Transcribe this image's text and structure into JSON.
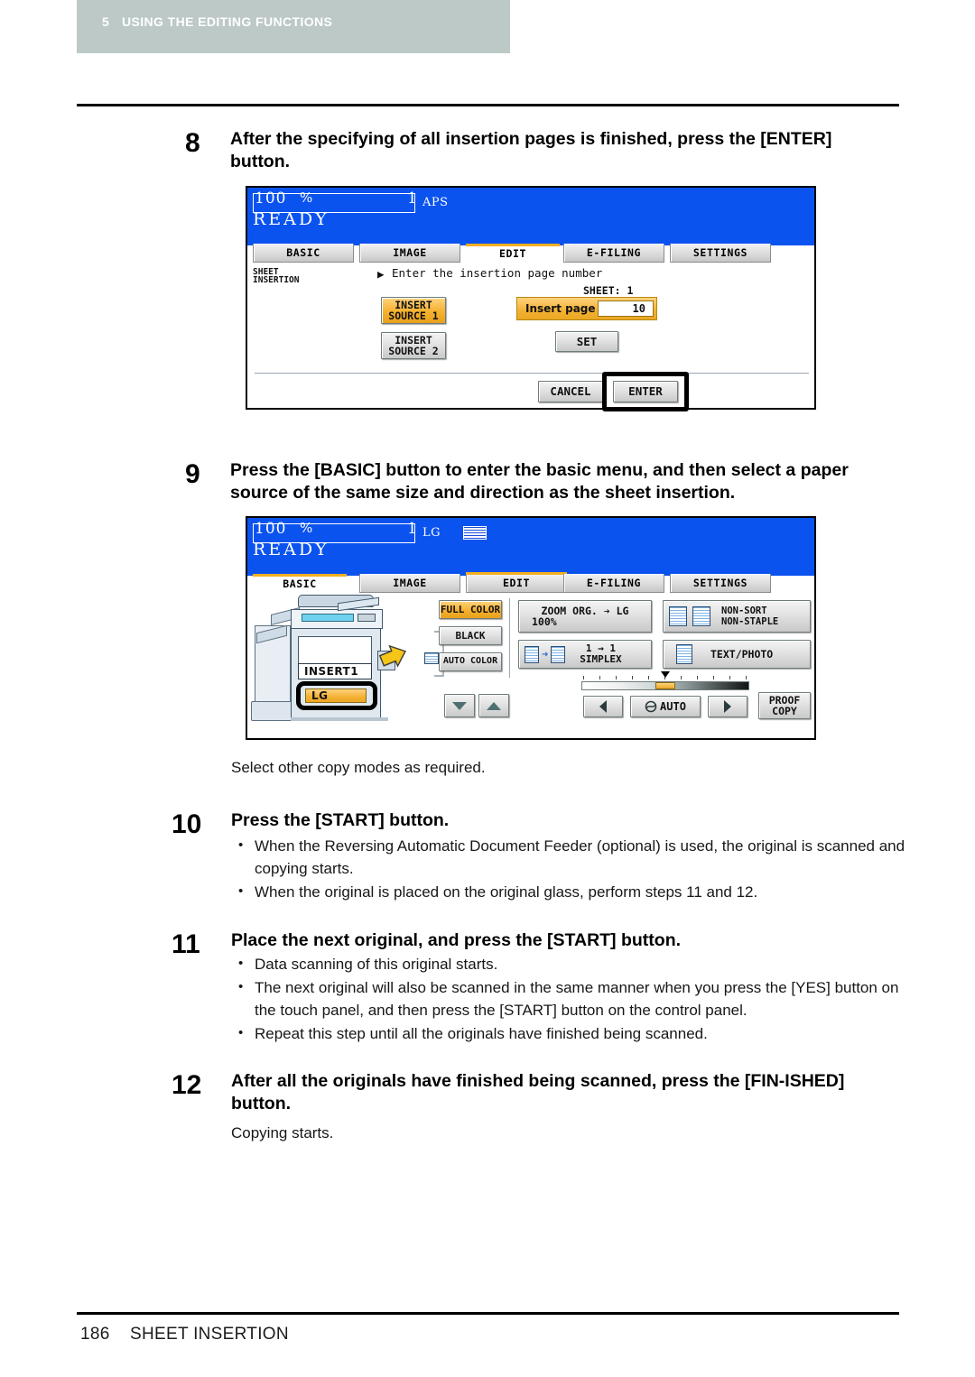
{
  "header": {
    "chapter_number": "5",
    "chapter_title": "USING THE EDITING FUNCTIONS"
  },
  "footer": {
    "page_number": "186",
    "section_title": "SHEET INSERTION"
  },
  "steps": [
    {
      "number": "8",
      "heading": "After the specifying of all insertion pages is finished, press the [ENTER] button."
    },
    {
      "number": "9",
      "heading": "Press the [BASIC] button to enter the basic menu, and then select a paper source of the same size and direction as the sheet insertion.",
      "note": "Select other copy modes as required."
    },
    {
      "number": "10",
      "heading": "Press the [START] button.",
      "bullets": [
        "When the Reversing Automatic Document Feeder (optional) is used, the original is scanned and copying starts.",
        "When the original is placed on the original glass, perform steps 11 and 12."
      ]
    },
    {
      "number": "11",
      "heading": "Place the next original, and press the [START] button.",
      "bullets": [
        "Data scanning of this original starts.",
        "The next original will also be scanned in the same manner when you press the [YES] button on the touch panel, and then press the [START] button on the control panel.",
        "Repeat this step until all the originals have finished being scanned."
      ]
    },
    {
      "number": "12",
      "heading": "After all the originals have finished being scanned, press the [FIN-ISHED] button.",
      "note": "Copying starts."
    }
  ],
  "panel_edit": {
    "status": {
      "ratio": "100",
      "percent": "%",
      "copies": "1",
      "paper_size": "APS",
      "ready": "READY"
    },
    "tabs": [
      {
        "label": "BASIC",
        "active": false
      },
      {
        "label": "IMAGE",
        "active": false
      },
      {
        "label": "EDIT",
        "active": true
      },
      {
        "label": "E-FILING",
        "active": false
      },
      {
        "label": "SETTINGS",
        "active": false
      }
    ],
    "function_label_line1": "SHEET",
    "function_label_line2": "INSERTION",
    "guide_arrow": "▶",
    "guide_text": "Enter the insertion page number",
    "sheet_counter": "SHEET: 1",
    "insert_source_1": "INSERT\nSOURCE 1",
    "insert_source_2": "INSERT\nSOURCE 2",
    "insert_page_label": "Insert page",
    "insert_page_colon": ":",
    "insert_page_value": "10",
    "set_button": "SET",
    "cancel_button": "CANCEL",
    "enter_button": "ENTER"
  },
  "panel_basic": {
    "status": {
      "ratio": "100",
      "percent": "%",
      "copies": "1",
      "paper_size": "LG",
      "ready": "READY"
    },
    "tabs": [
      {
        "label": "BASIC",
        "active": true
      },
      {
        "label": "IMAGE",
        "active": false
      },
      {
        "label": "EDIT",
        "active": false
      },
      {
        "label": "E-FILING",
        "active": false
      },
      {
        "label": "SETTINGS",
        "active": false
      }
    ],
    "drawer_insert1": "INSERT1",
    "drawer_lg": "LG",
    "color_modes": [
      {
        "label": "FULL COLOR",
        "selected": true
      },
      {
        "label": "BLACK",
        "selected": false
      },
      {
        "label": "AUTO COLOR",
        "selected": false
      }
    ],
    "zoom_button": {
      "title": "ZOOM   ORG. ➔ LG",
      "value": "100%"
    },
    "duplex_button": {
      "line1": "1 → 1",
      "line2": "SIMPLEX",
      "page_num_from": "1",
      "page_num_to": "1"
    },
    "finishing_button": "NON-SORT\nNON-STAPLE",
    "original_mode_button": "TEXT/PHOTO",
    "exposure_auto_button": "AUTO",
    "exposure_left_arrow": "◀",
    "exposure_right_arrow": "▶",
    "proof_copy_button": "PROOF\nCOPY"
  }
}
